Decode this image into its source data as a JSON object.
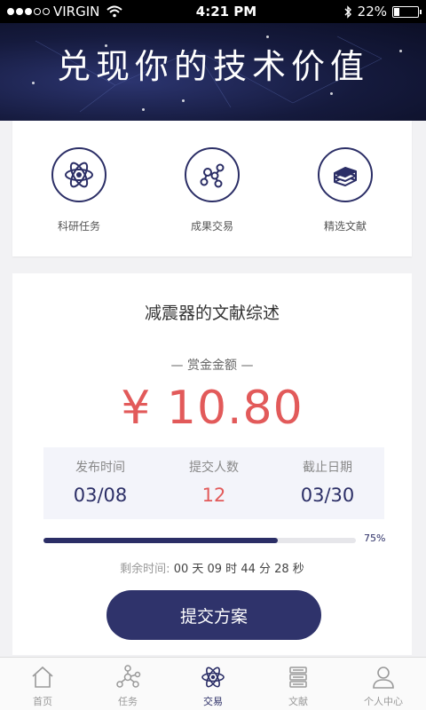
{
  "status_bar": {
    "carrier": "VIRGIN",
    "time": "4:21 PM",
    "battery": "22%",
    "battery_level": 0.22
  },
  "banner": {
    "title": "兑现你的技术价值"
  },
  "categories": [
    {
      "label": "科研任务",
      "icon": "atom-icon"
    },
    {
      "label": "成果交易",
      "icon": "molecule-icon"
    },
    {
      "label": "精选文献",
      "icon": "books-icon"
    }
  ],
  "task": {
    "title": "减震器的文献综述",
    "reward_label": "— 赏金金额 —",
    "reward_amount": "¥ 10.80",
    "stats": [
      {
        "label": "发布时间",
        "value": "03/08"
      },
      {
        "label": "提交人数",
        "value": "12"
      },
      {
        "label": "截止日期",
        "value": "03/30"
      }
    ],
    "progress": 0.75,
    "progress_label": "75%",
    "remaining_label": "剩余时间:",
    "remaining_time": "00 天 09 时 44 分 28 秒",
    "submit_label": "提交方案"
  },
  "tabs": [
    {
      "label": "首页",
      "icon": "home-icon"
    },
    {
      "label": "任务",
      "icon": "network-icon"
    },
    {
      "label": "交易",
      "icon": "atom-icon"
    },
    {
      "label": "文献",
      "icon": "books-icon"
    },
    {
      "label": "个人中心",
      "icon": "user-icon"
    }
  ],
  "active_tab": 2,
  "colors": {
    "primary": "#2b2e66",
    "accent_red": "#e25a5a"
  }
}
